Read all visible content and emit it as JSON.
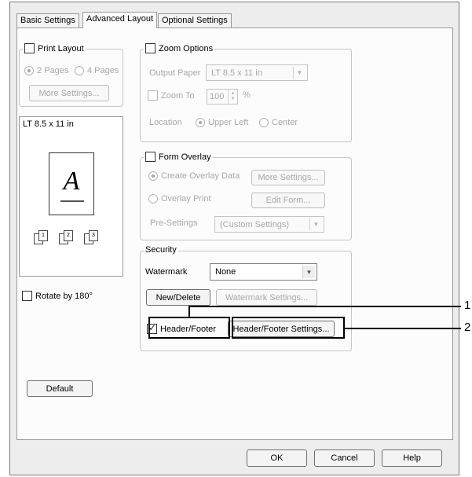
{
  "tabs": [
    {
      "label": "Basic Settings",
      "active": false
    },
    {
      "label": "Advanced Layout",
      "active": true
    },
    {
      "label": "Optional Settings",
      "active": false
    }
  ],
  "print_layout": {
    "label": "Print Layout",
    "checked": false,
    "options": [
      "2 Pages",
      "4 Pages"
    ],
    "selected": "2 Pages",
    "more_settings": "More Settings..."
  },
  "preview": {
    "paper_label": "LT 8.5 x 11 in",
    "sample_letter": "A",
    "copy_numbers": [
      "1",
      "2",
      "3"
    ]
  },
  "rotate": {
    "label": "Rotate by 180°",
    "checked": false
  },
  "default_button": "Default",
  "zoom": {
    "label": "Zoom Options",
    "checked": false,
    "output_paper_label": "Output Paper",
    "output_paper_value": "LT 8.5 x 11 in",
    "zoom_to_label": "Zoom To",
    "zoom_value": "100",
    "percent": "%",
    "location_label": "Location",
    "location_options": [
      "Upper Left",
      "Center"
    ],
    "location_selected": "Upper Left"
  },
  "form_overlay": {
    "label": "Form Overlay",
    "checked": false,
    "create_label": "Create Overlay Data",
    "more_settings": "More Settings...",
    "overlay_print_label": "Overlay Print",
    "edit_form": "Edit Form...",
    "presettings_label": "Pre-Settings",
    "presettings_value": "(Custom Settings)"
  },
  "security": {
    "label": "Security",
    "watermark_label": "Watermark",
    "watermark_value": "None",
    "new_delete": "New/Delete",
    "watermark_settings": "Watermark Settings...",
    "header_footer_label": "Header/Footer",
    "header_footer_checked": true,
    "header_footer_settings": "Header/Footer Settings..."
  },
  "buttons": {
    "ok": "OK",
    "cancel": "Cancel",
    "help": "Help"
  },
  "callouts": [
    "1",
    "2"
  ]
}
